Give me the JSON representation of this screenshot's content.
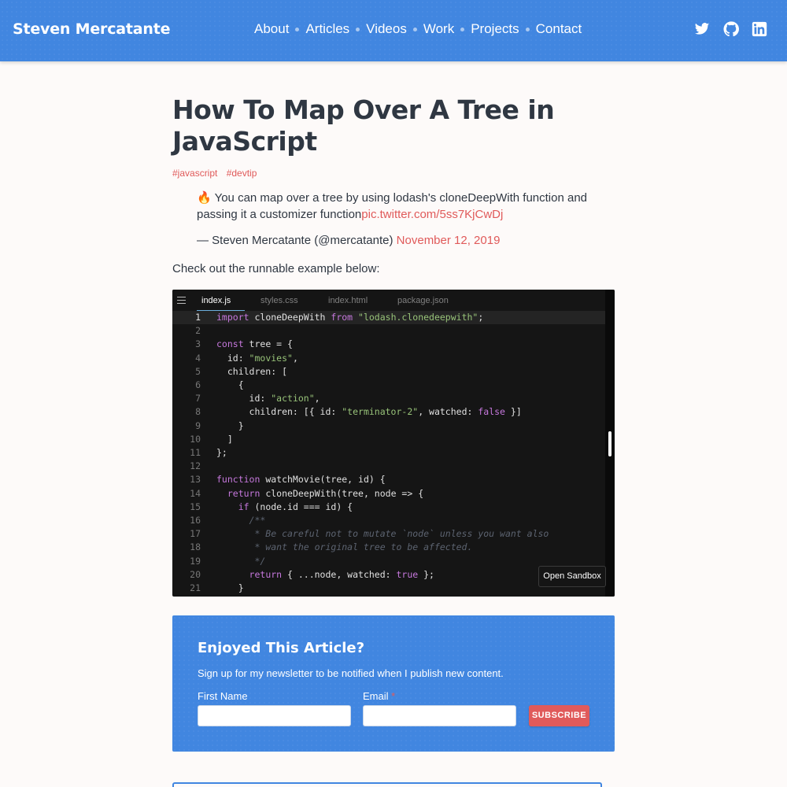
{
  "header": {
    "brand": "Steven Mercatante",
    "nav": [
      "About",
      "Articles",
      "Videos",
      "Work",
      "Projects",
      "Contact"
    ],
    "social_icons": [
      "twitter-icon",
      "github-icon",
      "linkedin-icon"
    ]
  },
  "article": {
    "title": "How To Map Over A Tree in JavaScript",
    "tags": [
      "#javascript",
      "#devtip"
    ],
    "tweet": {
      "emoji": "🔥",
      "text": " You can map over a tree by using lodash's cloneDeepWith function and passing it a customizer function",
      "link": "pic.twitter.com/5ss7KjCwDj",
      "byline": "— Steven Mercatante (@mercatante) ",
      "date": "November 12, 2019"
    },
    "intro": "Check out the runnable example below:"
  },
  "sandbox": {
    "tabs": [
      "index.js",
      "styles.css",
      "index.html",
      "package.json"
    ],
    "active_tab": 0,
    "current_line": 1,
    "open_button": "Open Sandbox",
    "lines": [
      [
        [
          "kw",
          "import"
        ],
        [
          "",
          " cloneDeepWith "
        ],
        [
          "kw",
          "from"
        ],
        [
          "str",
          " \"lodash.clonedeepwith\""
        ],
        [
          "",
          ";"
        ]
      ],
      [],
      [
        [
          "kw",
          "const"
        ],
        [
          "",
          " tree = {"
        ]
      ],
      [
        [
          "",
          "  id: "
        ],
        [
          "str",
          "\"movies\""
        ],
        [
          "",
          ","
        ]
      ],
      [
        [
          "",
          "  children: ["
        ]
      ],
      [
        [
          "",
          "    {"
        ]
      ],
      [
        [
          "",
          "      id: "
        ],
        [
          "str",
          "\"action\""
        ],
        [
          "",
          ","
        ]
      ],
      [
        [
          "",
          "      children: [{ id: "
        ],
        [
          "str",
          "\"terminator-2\""
        ],
        [
          "",
          ", watched: "
        ],
        [
          "kw",
          "false"
        ],
        [
          "",
          " }]"
        ]
      ],
      [
        [
          "",
          "    }"
        ]
      ],
      [
        [
          "",
          "  ]"
        ]
      ],
      [
        [
          "",
          "};"
        ]
      ],
      [],
      [
        [
          "kw",
          "function"
        ],
        [
          "",
          " watchMovie(tree, id) {"
        ]
      ],
      [
        [
          "",
          "  "
        ],
        [
          "kw",
          "return"
        ],
        [
          "",
          " cloneDeepWith(tree, node => {"
        ]
      ],
      [
        [
          "",
          "    "
        ],
        [
          "kw",
          "if"
        ],
        [
          "",
          " (node.id === id) {"
        ]
      ],
      [
        [
          "cm",
          "      /**"
        ]
      ],
      [
        [
          "cm",
          "       * Be careful not to mutate `node` unless you want also"
        ]
      ],
      [
        [
          "cm",
          "       * want the original tree to be affected."
        ]
      ],
      [
        [
          "cm",
          "       */"
        ]
      ],
      [
        [
          "",
          "      "
        ],
        [
          "kw",
          "return"
        ],
        [
          "",
          " { ...node, watched: "
        ],
        [
          "kw",
          "true"
        ],
        [
          "",
          " };"
        ]
      ],
      [
        [
          "",
          "    }"
        ]
      ]
    ]
  },
  "newsletter": {
    "title": "Enjoyed This Article?",
    "subtitle": "Sign up for my newsletter to be notified when I publish new content.",
    "first_name_label": "First Name",
    "email_label": "Email",
    "required_mark": "*",
    "first_name_value": "",
    "email_value": "",
    "button": "SUBSCRIBE"
  },
  "colors": {
    "header_bg": "#4186e0",
    "accent_red": "#e05a5a",
    "page_bg": "#fdfaf9",
    "code_bg": "#151515"
  }
}
